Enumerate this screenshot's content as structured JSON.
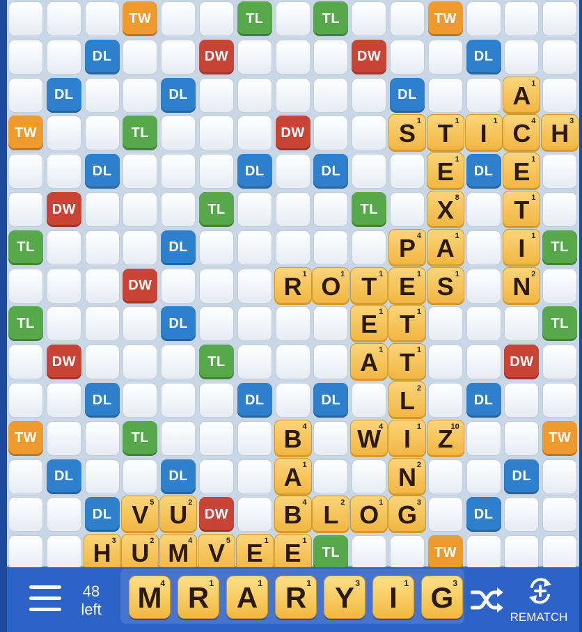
{
  "premium_squares": [
    {
      "row": 0,
      "col": 3,
      "type": "TW"
    },
    {
      "row": 0,
      "col": 6,
      "type": "TL"
    },
    {
      "row": 0,
      "col": 8,
      "type": "TL"
    },
    {
      "row": 0,
      "col": 11,
      "type": "TW"
    },
    {
      "row": 1,
      "col": 2,
      "type": "DL"
    },
    {
      "row": 1,
      "col": 5,
      "type": "DW"
    },
    {
      "row": 1,
      "col": 9,
      "type": "DW"
    },
    {
      "row": 1,
      "col": 12,
      "type": "DL"
    },
    {
      "row": 2,
      "col": 1,
      "type": "DL"
    },
    {
      "row": 2,
      "col": 4,
      "type": "DL"
    },
    {
      "row": 2,
      "col": 10,
      "type": "DL"
    },
    {
      "row": 3,
      "col": 0,
      "type": "TW"
    },
    {
      "row": 3,
      "col": 3,
      "type": "TL"
    },
    {
      "row": 3,
      "col": 7,
      "type": "DW"
    },
    {
      "row": 4,
      "col": 2,
      "type": "DL"
    },
    {
      "row": 4,
      "col": 6,
      "type": "DL"
    },
    {
      "row": 4,
      "col": 8,
      "type": "DL"
    },
    {
      "row": 4,
      "col": 12,
      "type": "DL"
    },
    {
      "row": 5,
      "col": 1,
      "type": "DW"
    },
    {
      "row": 5,
      "col": 5,
      "type": "TL"
    },
    {
      "row": 5,
      "col": 9,
      "type": "TL"
    },
    {
      "row": 6,
      "col": 0,
      "type": "TL"
    },
    {
      "row": 6,
      "col": 4,
      "type": "DL"
    },
    {
      "row": 6,
      "col": 14,
      "type": "TL"
    },
    {
      "row": 7,
      "col": 3,
      "type": "DW"
    },
    {
      "row": 8,
      "col": 0,
      "type": "TL"
    },
    {
      "row": 8,
      "col": 4,
      "type": "DL"
    },
    {
      "row": 8,
      "col": 14,
      "type": "TL"
    },
    {
      "row": 9,
      "col": 1,
      "type": "DW"
    },
    {
      "row": 9,
      "col": 5,
      "type": "TL"
    },
    {
      "row": 9,
      "col": 13,
      "type": "DW"
    },
    {
      "row": 10,
      "col": 2,
      "type": "DL"
    },
    {
      "row": 10,
      "col": 6,
      "type": "DL"
    },
    {
      "row": 10,
      "col": 8,
      "type": "DL"
    },
    {
      "row": 10,
      "col": 12,
      "type": "DL"
    },
    {
      "row": 11,
      "col": 0,
      "type": "TW"
    },
    {
      "row": 11,
      "col": 3,
      "type": "TL"
    },
    {
      "row": 11,
      "col": 14,
      "type": "TW"
    },
    {
      "row": 12,
      "col": 1,
      "type": "DL"
    },
    {
      "row": 12,
      "col": 4,
      "type": "DL"
    },
    {
      "row": 12,
      "col": 13,
      "type": "DL"
    },
    {
      "row": 13,
      "col": 2,
      "type": "DL"
    },
    {
      "row": 13,
      "col": 5,
      "type": "DW"
    },
    {
      "row": 13,
      "col": 12,
      "type": "DL"
    },
    {
      "row": 14,
      "col": 8,
      "type": "TL"
    },
    {
      "row": 14,
      "col": 11,
      "type": "TW"
    }
  ],
  "premium_colors": {
    "TW": "#ef9a2c",
    "TL": "#56a84a",
    "DW": "#c94436",
    "DL": "#2f80cc"
  },
  "board_tiles": [
    {
      "row": 2,
      "col": 13,
      "letter": "A",
      "points": "1"
    },
    {
      "row": 3,
      "col": 10,
      "letter": "S",
      "points": "1"
    },
    {
      "row": 3,
      "col": 11,
      "letter": "T",
      "points": "1"
    },
    {
      "row": 3,
      "col": 12,
      "letter": "I",
      "points": "1"
    },
    {
      "row": 3,
      "col": 13,
      "letter": "C",
      "points": "4"
    },
    {
      "row": 3,
      "col": 14,
      "letter": "H",
      "points": "3"
    },
    {
      "row": 4,
      "col": 11,
      "letter": "E",
      "points": "1"
    },
    {
      "row": 4,
      "col": 13,
      "letter": "E",
      "points": "1"
    },
    {
      "row": 5,
      "col": 11,
      "letter": "X",
      "points": "8"
    },
    {
      "row": 5,
      "col": 13,
      "letter": "T",
      "points": "1"
    },
    {
      "row": 6,
      "col": 10,
      "letter": "P",
      "points": "4"
    },
    {
      "row": 6,
      "col": 11,
      "letter": "A",
      "points": "1"
    },
    {
      "row": 6,
      "col": 13,
      "letter": "I",
      "points": "1"
    },
    {
      "row": 7,
      "col": 7,
      "letter": "R",
      "points": "1"
    },
    {
      "row": 7,
      "col": 8,
      "letter": "O",
      "points": "1"
    },
    {
      "row": 7,
      "col": 9,
      "letter": "T",
      "points": "1"
    },
    {
      "row": 7,
      "col": 10,
      "letter": "E",
      "points": "1"
    },
    {
      "row": 7,
      "col": 11,
      "letter": "S",
      "points": "1"
    },
    {
      "row": 7,
      "col": 13,
      "letter": "N",
      "points": "2"
    },
    {
      "row": 8,
      "col": 9,
      "letter": "E",
      "points": "1"
    },
    {
      "row": 8,
      "col": 10,
      "letter": "T",
      "points": "1"
    },
    {
      "row": 9,
      "col": 9,
      "letter": "A",
      "points": "1"
    },
    {
      "row": 9,
      "col": 10,
      "letter": "T",
      "points": "1"
    },
    {
      "row": 10,
      "col": 10,
      "letter": "L",
      "points": "2"
    },
    {
      "row": 11,
      "col": 7,
      "letter": "B",
      "points": "4"
    },
    {
      "row": 11,
      "col": 9,
      "letter": "W",
      "points": "4"
    },
    {
      "row": 11,
      "col": 10,
      "letter": "I",
      "points": "1"
    },
    {
      "row": 11,
      "col": 11,
      "letter": "Z",
      "points": "10"
    },
    {
      "row": 12,
      "col": 7,
      "letter": "A",
      "points": "1"
    },
    {
      "row": 12,
      "col": 10,
      "letter": "N",
      "points": "2"
    },
    {
      "row": 13,
      "col": 3,
      "letter": "V",
      "points": "5"
    },
    {
      "row": 13,
      "col": 4,
      "letter": "U",
      "points": "2"
    },
    {
      "row": 13,
      "col": 7,
      "letter": "B",
      "points": "4"
    },
    {
      "row": 13,
      "col": 8,
      "letter": "L",
      "points": "2"
    },
    {
      "row": 13,
      "col": 9,
      "letter": "O",
      "points": "1"
    },
    {
      "row": 13,
      "col": 10,
      "letter": "G",
      "points": "3"
    },
    {
      "row": 14,
      "col": 2,
      "letter": "H",
      "points": "3"
    },
    {
      "row": 14,
      "col": 3,
      "letter": "U",
      "points": "2"
    },
    {
      "row": 14,
      "col": 4,
      "letter": "M",
      "points": "4"
    },
    {
      "row": 14,
      "col": 5,
      "letter": "V",
      "points": "5"
    },
    {
      "row": 14,
      "col": 6,
      "letter": "E",
      "points": "1"
    },
    {
      "row": 14,
      "col": 7,
      "letter": "E",
      "points": "1"
    }
  ],
  "bag": {
    "count": "48",
    "label": "left"
  },
  "rack": [
    {
      "letter": "M",
      "points": "4"
    },
    {
      "letter": "R",
      "points": "1"
    },
    {
      "letter": "A",
      "points": "1"
    },
    {
      "letter": "R",
      "points": "1"
    },
    {
      "letter": "Y",
      "points": "3"
    },
    {
      "letter": "I",
      "points": "1"
    },
    {
      "letter": "G",
      "points": "3"
    }
  ],
  "controls": {
    "menu_icon": "hamburger-menu-icon",
    "shuffle_icon": "shuffle-icon",
    "rematch_icon": "rematch-icon",
    "rematch_label": "REMATCH"
  }
}
